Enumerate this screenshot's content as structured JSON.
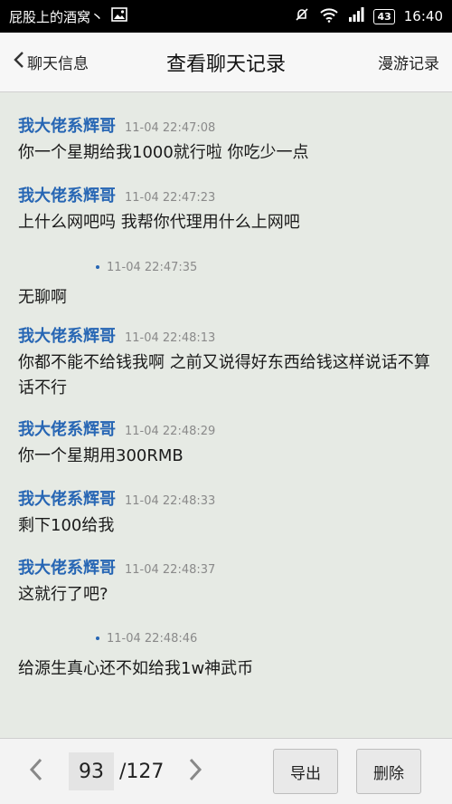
{
  "statusbar": {
    "notification": "屁股上的酒窝丶",
    "battery": "43",
    "time": "16:40"
  },
  "header": {
    "back_label": "聊天信息",
    "title": "查看聊天记录",
    "roam_label": "漫游记录"
  },
  "messages": [
    {
      "sender": "我大佬系辉哥",
      "time": "11-04 22:47:08",
      "text": "你一个星期给我1000就行啦 你吃少一点"
    },
    {
      "sender": "我大佬系辉哥",
      "time": "11-04 22:47:23",
      "text": "上什么网吧吗 我帮你代理用什么上网吧"
    },
    {
      "sender": "",
      "time": "11-04 22:47:35",
      "text": "无聊啊"
    },
    {
      "sender": "我大佬系辉哥",
      "time": "11-04 22:48:13",
      "text": "你都不能不给钱我啊 之前又说得好东西给钱这样说话不算话不行"
    },
    {
      "sender": "我大佬系辉哥",
      "time": "11-04 22:48:29",
      "text": "你一个星期用300RMB"
    },
    {
      "sender": "我大佬系辉哥",
      "time": "11-04 22:48:33",
      "text": "剩下100给我"
    },
    {
      "sender": "我大佬系辉哥",
      "time": "11-04 22:48:37",
      "text": "这就行了吧?"
    },
    {
      "sender": "",
      "time": "11-04 22:48:46",
      "text": "给源生真心还不如给我1w神武币"
    }
  ],
  "pager": {
    "current": "93",
    "total": "/127"
  },
  "actions": {
    "export_label": "导出",
    "delete_label": "删除"
  },
  "colors": {
    "sender": "#2766b4",
    "background": "#e6eae4"
  }
}
